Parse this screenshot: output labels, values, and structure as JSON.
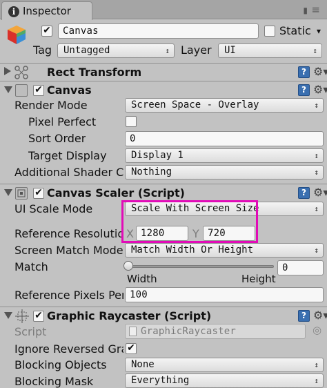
{
  "tab": {
    "title": "Inspector",
    "info_icon": "i"
  },
  "header_icons": {
    "lock": "▮",
    "menu": "≡"
  },
  "object": {
    "name": "Canvas",
    "active": true,
    "static_label": "Static",
    "static_arrow": "▾",
    "tag_label": "Tag",
    "tag_value": "Untagged",
    "layer_label": "Layer",
    "layer_value": "UI"
  },
  "rect_transform": {
    "title": "Rect Transform"
  },
  "canvas": {
    "title": "Canvas",
    "enabled": true,
    "render_mode_label": "Render Mode",
    "render_mode_value": "Screen Space - Overlay",
    "pixel_perfect_label": "Pixel Perfect",
    "pixel_perfect": false,
    "sort_order_label": "Sort Order",
    "sort_order_value": "0",
    "target_display_label": "Target Display",
    "target_display_value": "Display 1",
    "shader_channels_label": "Additional Shader Channels",
    "shader_channels_value": "Nothing"
  },
  "canvas_scaler": {
    "title": "Canvas Scaler (Script)",
    "enabled": true,
    "ui_scale_mode_label": "UI Scale Mode",
    "ui_scale_mode_value": "Scale With Screen Size",
    "ref_resolution_label": "Reference Resolution",
    "x_label": "X",
    "x_value": "1280",
    "y_label": "Y",
    "y_value": "720",
    "screen_match_label": "Screen Match Mode",
    "screen_match_value": "Match Width Or Height",
    "match_label": "Match",
    "match_value": "0",
    "match_slider": 0,
    "width_label": "Width",
    "height_label": "Height",
    "ref_pixels_label": "Reference Pixels Per Unit",
    "ref_pixels_value": "100"
  },
  "graphic_raycaster": {
    "title": "Graphic Raycaster (Script)",
    "enabled": true,
    "script_label": "Script",
    "script_value": "GraphicRaycaster",
    "ignore_reversed_label": "Ignore Reversed Graphics",
    "ignore_reversed": true,
    "blocking_objects_label": "Blocking Objects",
    "blocking_objects_value": "None",
    "blocking_mask_label": "Blocking Mask",
    "blocking_mask_value": "Everything"
  },
  "glyphs": {
    "check": "✔",
    "dropdown": "↕",
    "help": "?",
    "gear": "⚙▾",
    "target": "◎"
  },
  "colors": {
    "highlight": "#e20bb8",
    "help": "#3a6fb0",
    "background": "#c2c2c2"
  }
}
